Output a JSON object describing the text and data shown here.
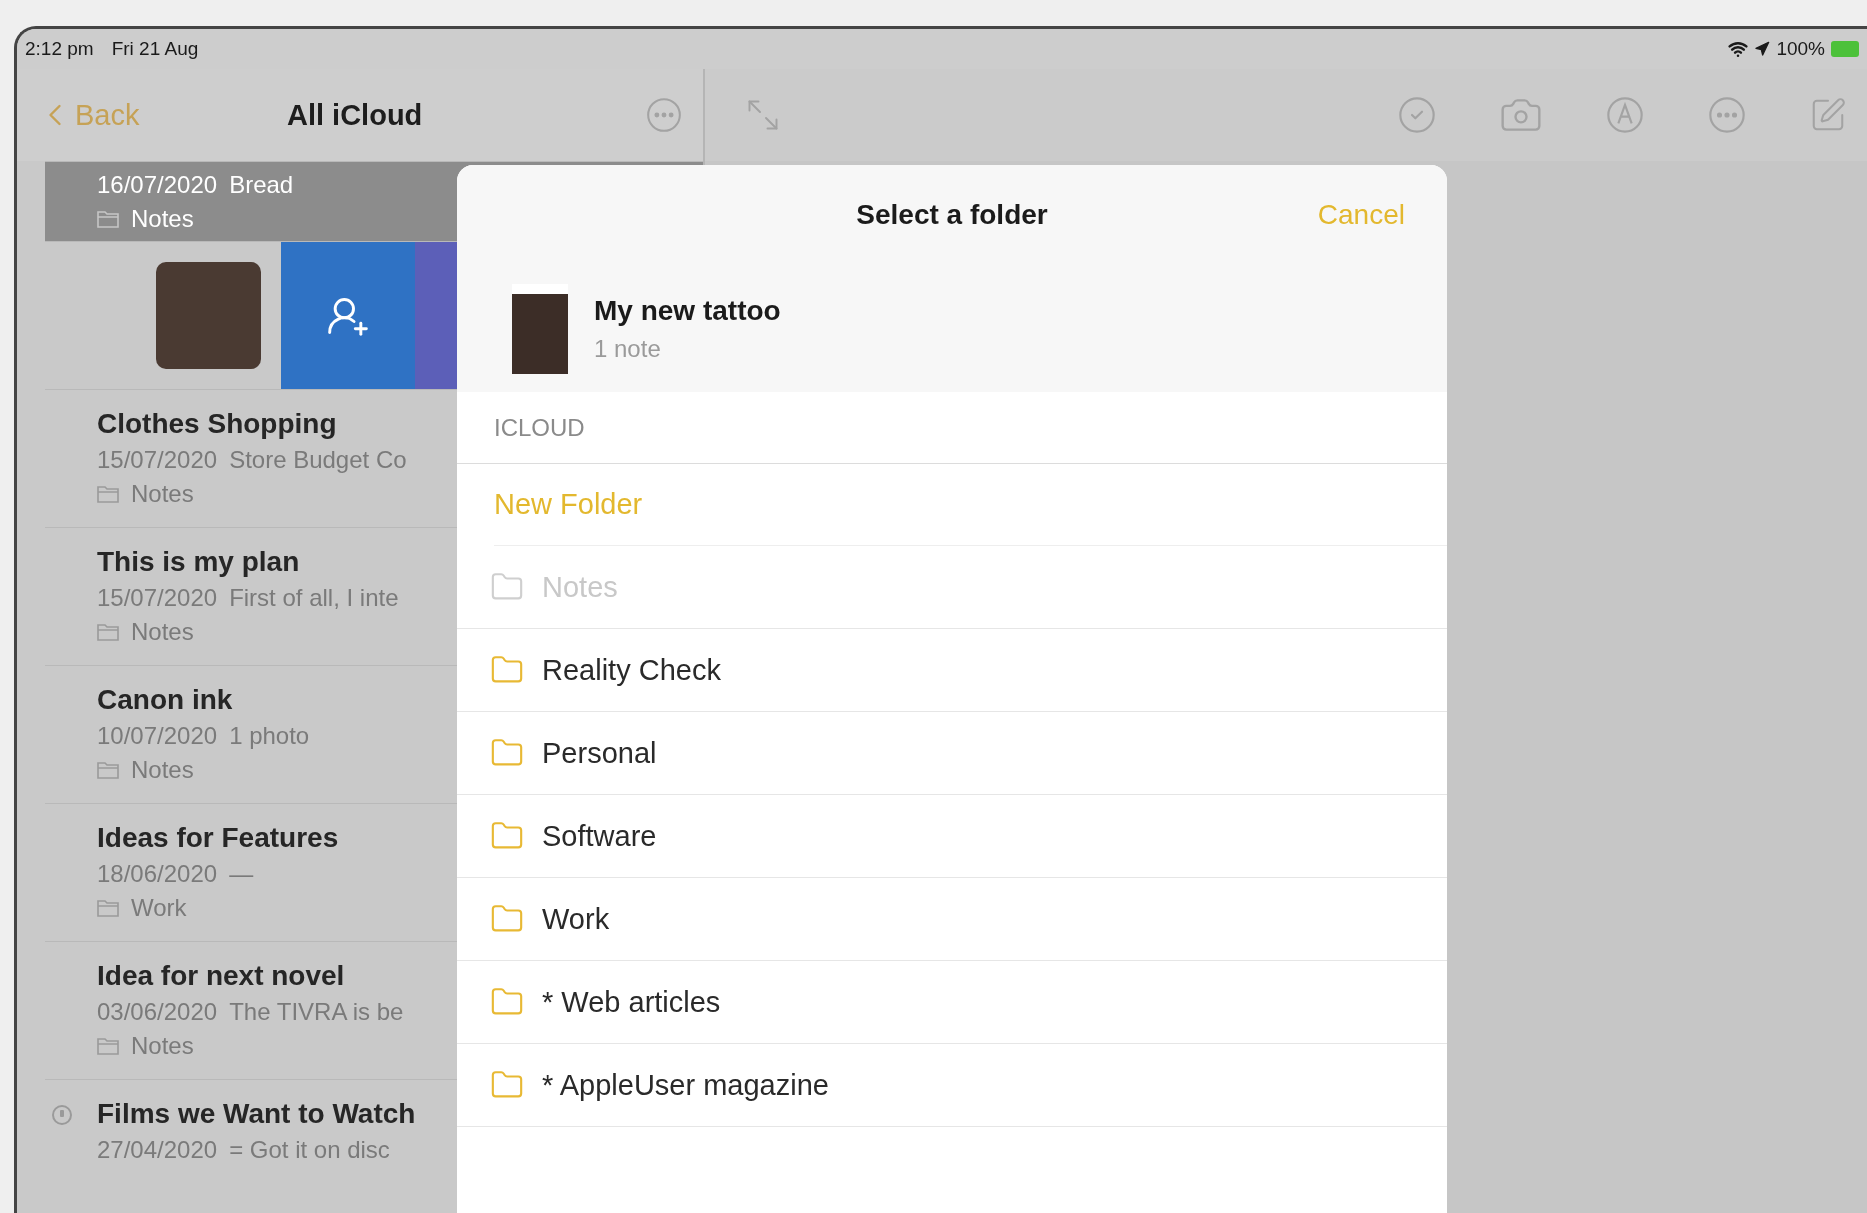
{
  "status_bar": {
    "time": "2:12 pm",
    "date": "Fri 21 Aug",
    "battery": "100%",
    "charging": true
  },
  "nav": {
    "back": "Back",
    "title": "All iCloud"
  },
  "notes": [
    {
      "kind": "note",
      "date": "16/07/2020",
      "preview": "Bread",
      "folder": "Notes",
      "selected": true,
      "badge": false
    },
    {
      "kind": "swiped",
      "selected": false
    },
    {
      "kind": "note",
      "title": "Clothes Shopping",
      "date": "15/07/2020",
      "preview": "Store Budget Co",
      "folder": "Notes",
      "selected": false,
      "badge": false
    },
    {
      "kind": "note",
      "title": "This is my plan",
      "date": "15/07/2020",
      "preview": "First of all, I inte",
      "folder": "Notes",
      "selected": false,
      "badge": false
    },
    {
      "kind": "note",
      "title": "Canon ink",
      "date": "10/07/2020",
      "preview": "1 photo",
      "folder": "Notes",
      "selected": false,
      "badge": false
    },
    {
      "kind": "note",
      "title": "Ideas for Features",
      "date": "18/06/2020",
      "preview": "—",
      "folder": "Work",
      "selected": false,
      "badge": false
    },
    {
      "kind": "note",
      "title": "Idea for next novel",
      "date": "03/06/2020",
      "preview": "The TIVRA is be",
      "folder": "Notes",
      "selected": false,
      "badge": false
    },
    {
      "kind": "note",
      "title": "Films we Want to Watch",
      "date": "27/04/2020",
      "preview": "= Got it on disc",
      "selected": false,
      "badge": true
    }
  ],
  "modal": {
    "title": "Select a folder",
    "cancel": "Cancel",
    "note": {
      "title": "My new tattoo",
      "count": "1 note"
    },
    "section": "ICLOUD",
    "new_folder": "New Folder",
    "folders": [
      {
        "name": "Notes",
        "disabled": true
      },
      {
        "name": "Reality Check",
        "disabled": false
      },
      {
        "name": "Personal",
        "disabled": false
      },
      {
        "name": "Software",
        "disabled": false
      },
      {
        "name": "Work",
        "disabled": false
      },
      {
        "name": "* Web articles",
        "disabled": false
      },
      {
        "name": "* AppleUser magazine",
        "disabled": false
      }
    ]
  }
}
